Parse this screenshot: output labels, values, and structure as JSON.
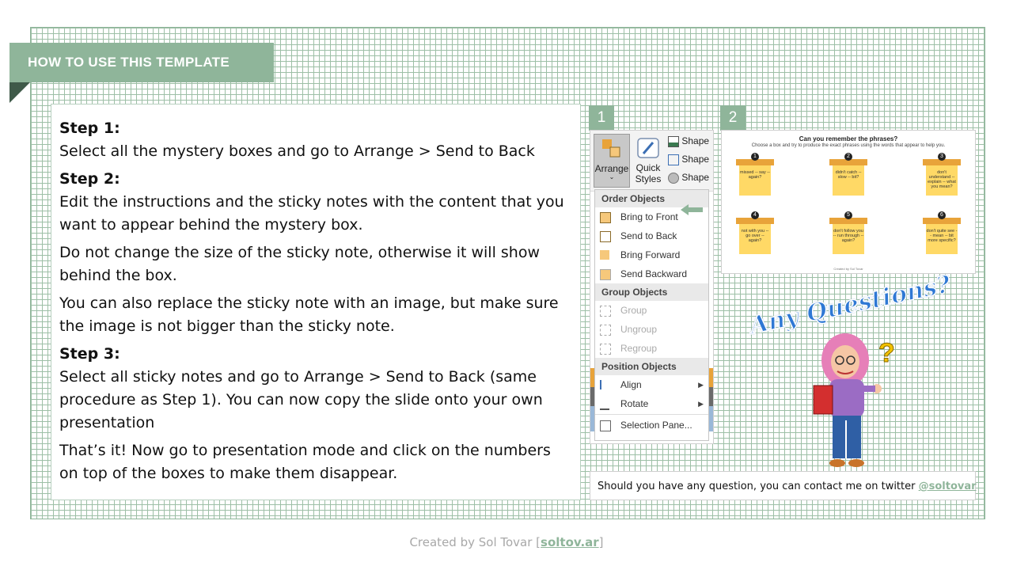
{
  "banner": {
    "title": "HOW TO USE THIS TEMPLATE"
  },
  "instructions": {
    "step1_label": "Step 1:",
    "step1_text": "Select all the mystery boxes and go to Arrange > Send to Back",
    "step2_label": "Step 2:",
    "step2_text": "Edit the instructions and the sticky notes with the content that you want to appear behind the mystery box.",
    "para_size": "Do not change the size of the sticky note, otherwise it will show behind the box.",
    "para_image": "You can also replace the sticky note with an image, but make sure the image is not bigger than the sticky note.",
    "step3_label": "Step 3:",
    "step3_text": "Select all sticky notes and go to Arrange > Send to Back (same procedure as Step 1). You can now copy the slide onto your own presentation",
    "para_done": "That’s it! Now go to presentation mode and click on the numbers on top of the boxes to make them disappear."
  },
  "badges": {
    "one": "1",
    "two": "2"
  },
  "ribbon": {
    "arrange": "Arrange",
    "quick": "Quick",
    "styles": "Styles",
    "shape1": "Shape",
    "shape2": "Shape",
    "shape3": "Shape"
  },
  "menu": {
    "order_header": "Order Objects",
    "bring_to_front": "Bring to Front",
    "send_to_back": "Send to Back",
    "bring_forward": "Bring Forward",
    "send_backward": "Send Backward",
    "group_header": "Group Objects",
    "group": "Group",
    "ungroup": "Ungroup",
    "regroup": "Regroup",
    "position_header": "Position Objects",
    "align": "Align",
    "rotate": "Rotate",
    "selection_pane": "Selection Pane..."
  },
  "preview": {
    "title": "Can you remember the phrases?",
    "subtitle": "Choose a box and try to produce the exact phrases using the words that appear to help you.",
    "boxes": [
      {
        "num": "1",
        "text": "missed -- say -- again?"
      },
      {
        "num": "2",
        "text": "didn't catch -- slow -- bit?"
      },
      {
        "num": "3",
        "text": "don't understand -- explain -- what you mean?"
      },
      {
        "num": "4",
        "text": "not with you -- go over -- again?"
      },
      {
        "num": "5",
        "text": "don't follow you -- run through -- again?"
      },
      {
        "num": "6",
        "text": "don't quite see -- mean -- bit more specific?"
      }
    ],
    "credit": "Created by Sol Tovar"
  },
  "questions": {
    "heading": "Any Questions?"
  },
  "contact": {
    "text": "Should you have any question, you can contact me on twitter ",
    "handle": "@soltovar"
  },
  "footer": {
    "prefix": "Created by Sol Tovar [",
    "link": "soltov.ar",
    "suffix": "]"
  },
  "colors": {
    "accent": "#8fb59a",
    "banner_dark": "#3f5a49",
    "lid": "#e8a33a",
    "note": "#ffd966"
  }
}
